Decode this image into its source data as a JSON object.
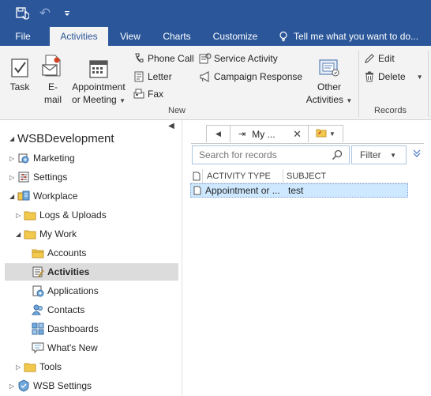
{
  "qat": {
    "save_icon": "save-sync-icon",
    "undo_icon": "undo-icon",
    "more_icon": "customize-qat-icon"
  },
  "tabs": {
    "file": "File",
    "activities": "Activities",
    "view": "View",
    "charts": "Charts",
    "customize": "Customize",
    "tellme": "Tell me what you want to do..."
  },
  "ribbon": {
    "task": "Task",
    "email_line1": "E-",
    "email_line2": "mail",
    "appointment_line1": "Appointment",
    "appointment_line2": "or Meeting",
    "phone_call": "Phone Call",
    "letter": "Letter",
    "fax": "Fax",
    "service_activity": "Service Activity",
    "campaign_response": "Campaign Response",
    "other_line1": "Other",
    "other_line2": "Activities",
    "edit": "Edit",
    "delete": "Delete",
    "group_new": "New",
    "group_records": "Records"
  },
  "nav": {
    "root": "WSBDevelopment",
    "marketing": "Marketing",
    "settings": "Settings",
    "workplace": "Workplace",
    "logs": "Logs & Uploads",
    "mywork": "My Work",
    "accounts": "Accounts",
    "activities": "Activities",
    "applications": "Applications",
    "contacts": "Contacts",
    "dashboards": "Dashboards",
    "whatsnew": "What's New",
    "tools": "Tools",
    "wsbsettings": "WSB Settings"
  },
  "view": {
    "tab_label": "My ...",
    "search_placeholder": "Search for records",
    "filter_label": "Filter",
    "columns": [
      "ACTIVITY TYPE",
      "SUBJECT"
    ],
    "rows": [
      {
        "activity_type": "Appointment or ...",
        "subject": "test"
      }
    ]
  },
  "colors": {
    "brand": "#2b579a",
    "selected_row": "#cde8ff",
    "selected_nav": "#dcdcdc"
  }
}
